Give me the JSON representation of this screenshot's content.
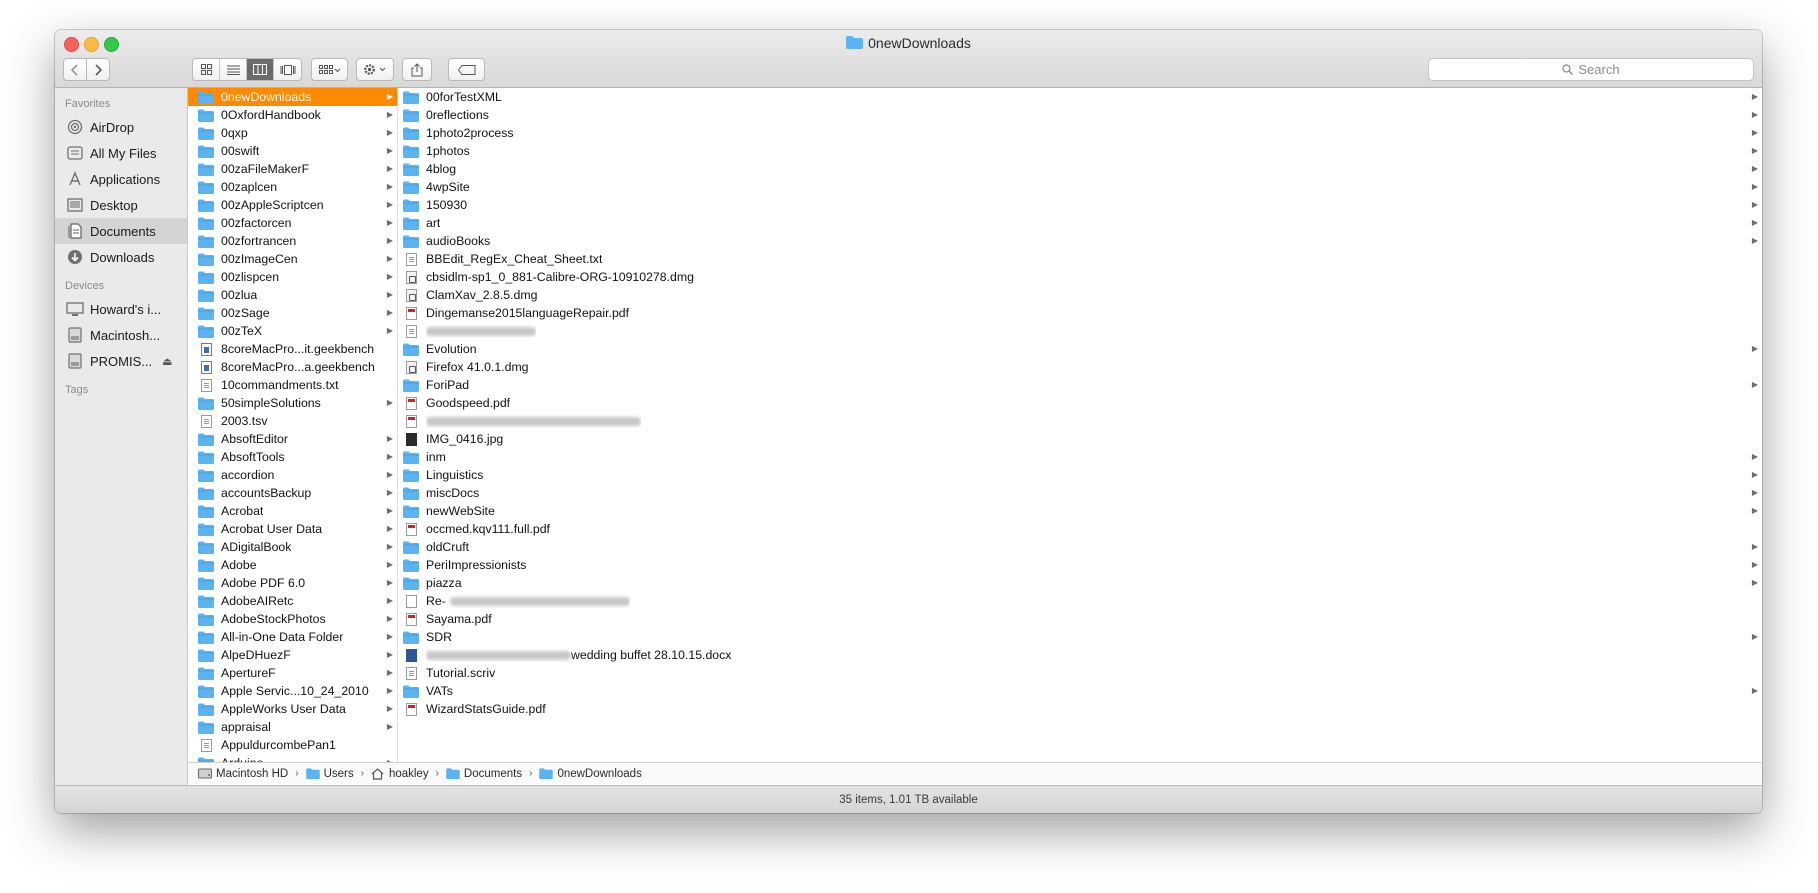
{
  "window": {
    "title": "0newDownloads"
  },
  "toolbar": {
    "search_placeholder": "Search"
  },
  "sidebar": {
    "favorites_header": "Favorites",
    "favorites": [
      {
        "label": "AirDrop",
        "icon": "airdrop-icon"
      },
      {
        "label": "All My Files",
        "icon": "all-my-files-icon"
      },
      {
        "label": "Applications",
        "icon": "applications-icon"
      },
      {
        "label": "Desktop",
        "icon": "desktop-icon"
      },
      {
        "label": "Documents",
        "icon": "documents-icon",
        "selected": true
      },
      {
        "label": "Downloads",
        "icon": "downloads-icon"
      }
    ],
    "devices_header": "Devices",
    "devices": [
      {
        "label": "Howard's i...",
        "icon": "computer-icon"
      },
      {
        "label": "Macintosh...",
        "icon": "disk-icon"
      },
      {
        "label": "PROMIS...",
        "icon": "disk-icon",
        "eject": "⏏"
      }
    ],
    "tags_header": "Tags"
  },
  "column1": [
    {
      "name": "0newDownloads",
      "type": "folder",
      "arrow": true,
      "selected": true
    },
    {
      "name": "0OxfordHandbook",
      "type": "folder",
      "arrow": true
    },
    {
      "name": "0qxp",
      "type": "folder",
      "arrow": true
    },
    {
      "name": "00swift",
      "type": "folder",
      "arrow": true
    },
    {
      "name": "00zaFileMakerF",
      "type": "folder",
      "arrow": true
    },
    {
      "name": "00zaplcen",
      "type": "folder",
      "arrow": true
    },
    {
      "name": "00zAppleScriptcen",
      "type": "folder",
      "arrow": true
    },
    {
      "name": "00zfactorcen",
      "type": "folder",
      "arrow": true
    },
    {
      "name": "00zfortrancen",
      "type": "folder",
      "arrow": true
    },
    {
      "name": "00zImageCen",
      "type": "folder",
      "arrow": true
    },
    {
      "name": "00zlispcen",
      "type": "folder",
      "arrow": true
    },
    {
      "name": "00zlua",
      "type": "folder",
      "arrow": true
    },
    {
      "name": "00zSage",
      "type": "folder",
      "arrow": true
    },
    {
      "name": "00zTeX",
      "type": "folder",
      "arrow": true
    },
    {
      "name": "8coreMacPro...it.geekbench",
      "type": "gb"
    },
    {
      "name": "8coreMacPro...a.geekbench",
      "type": "gb"
    },
    {
      "name": "10commandments.txt",
      "type": "txt"
    },
    {
      "name": "50simpleSolutions",
      "type": "folder",
      "arrow": true
    },
    {
      "name": "2003.tsv",
      "type": "txt"
    },
    {
      "name": "AbsoftEditor",
      "type": "folder",
      "arrow": true
    },
    {
      "name": "AbsoftTools",
      "type": "folder",
      "arrow": true
    },
    {
      "name": "accordion",
      "type": "folder",
      "arrow": true
    },
    {
      "name": "accountsBackup",
      "type": "folder",
      "arrow": true
    },
    {
      "name": "Acrobat",
      "type": "folder",
      "arrow": true
    },
    {
      "name": "Acrobat User Data",
      "type": "folder",
      "arrow": true
    },
    {
      "name": "ADigitalBook",
      "type": "folder",
      "arrow": true
    },
    {
      "name": "Adobe",
      "type": "folder",
      "arrow": true
    },
    {
      "name": "Adobe PDF 6.0",
      "type": "folder",
      "arrow": true
    },
    {
      "name": "AdobeAIRetc",
      "type": "folder",
      "arrow": true
    },
    {
      "name": "AdobeStockPhotos",
      "type": "folder",
      "arrow": true
    },
    {
      "name": "All-in-One Data Folder",
      "type": "folder",
      "arrow": true
    },
    {
      "name": "AlpeDHuezF",
      "type": "folder",
      "arrow": true
    },
    {
      "name": "ApertureF",
      "type": "folder",
      "arrow": true
    },
    {
      "name": "Apple Servic...10_24_2010",
      "type": "folder",
      "arrow": true
    },
    {
      "name": "AppleWorks User Data",
      "type": "folder",
      "arrow": true
    },
    {
      "name": "appraisal",
      "type": "folder",
      "arrow": true
    },
    {
      "name": "AppuldurcombePan1",
      "type": "txt"
    },
    {
      "name": "Arduino",
      "type": "folder",
      "arrow": true
    }
  ],
  "column2": [
    {
      "name": "00forTestXML",
      "type": "folder",
      "arrow": true
    },
    {
      "name": "0reflections",
      "type": "folder",
      "arrow": true
    },
    {
      "name": "1photo2process",
      "type": "folder",
      "arrow": true
    },
    {
      "name": "1photos",
      "type": "folder",
      "arrow": true
    },
    {
      "name": "4blog",
      "type": "folder",
      "arrow": true
    },
    {
      "name": "4wpSite",
      "type": "folder",
      "arrow": true
    },
    {
      "name": "150930",
      "type": "folder",
      "arrow": true
    },
    {
      "name": "art",
      "type": "folder",
      "arrow": true
    },
    {
      "name": "audioBooks",
      "type": "folder",
      "arrow": true
    },
    {
      "name": "BBEdit_RegEx_Cheat_Sheet.txt",
      "type": "txt"
    },
    {
      "name": "cbsidlm-sp1_0_881-Calibre-ORG-10910278.dmg",
      "type": "dmg"
    },
    {
      "name": "ClamXav_2.8.5.dmg",
      "type": "dmg"
    },
    {
      "name": "Dingemanse2015languageRepair.pdf",
      "type": "pdf"
    },
    {
      "name": "",
      "type": "txt",
      "blur": 110
    },
    {
      "name": "Evolution",
      "type": "folder",
      "arrow": true
    },
    {
      "name": "Firefox 41.0.1.dmg",
      "type": "dmg"
    },
    {
      "name": "ForiPad",
      "type": "folder",
      "arrow": true
    },
    {
      "name": "Goodspeed.pdf",
      "type": "pdf"
    },
    {
      "name": "",
      "type": "pdf",
      "blur": 215
    },
    {
      "name": "IMG_0416.jpg",
      "type": "img"
    },
    {
      "name": "inm",
      "type": "folder",
      "arrow": true
    },
    {
      "name": "Linguistics",
      "type": "folder",
      "arrow": true
    },
    {
      "name": "miscDocs",
      "type": "folder",
      "arrow": true
    },
    {
      "name": "newWebSite",
      "type": "folder",
      "arrow": true
    },
    {
      "name": "occmed.kqv111.full.pdf",
      "type": "pdf"
    },
    {
      "name": "oldCruft",
      "type": "folder",
      "arrow": true
    },
    {
      "name": "PeriImpressionists",
      "type": "folder",
      "arrow": true
    },
    {
      "name": "piazza",
      "type": "folder",
      "arrow": true
    },
    {
      "name": "Re-",
      "type": "blank",
      "blur": 180
    },
    {
      "name": "Sayama.pdf",
      "type": "pdf"
    },
    {
      "name": "SDR",
      "type": "folder",
      "arrow": true
    },
    {
      "name": "wedding buffet 28.10.15.docx",
      "type": "word",
      "blurBefore": 145
    },
    {
      "name": "Tutorial.scriv",
      "type": "txt"
    },
    {
      "name": "VATs",
      "type": "folder",
      "arrow": true
    },
    {
      "name": "WizardStatsGuide.pdf",
      "type": "pdf"
    }
  ],
  "pathbar": [
    {
      "label": "Macintosh HD",
      "icon": "hard-disk-icon"
    },
    {
      "label": "Users",
      "icon": "folder-icon"
    },
    {
      "label": "hoakley",
      "icon": "home-icon"
    },
    {
      "label": "Documents",
      "icon": "folder-icon"
    },
    {
      "label": "0newDownloads",
      "icon": "folder-icon"
    }
  ],
  "status": {
    "text": "35 items, 1.01 TB available"
  },
  "colors": {
    "selection": "#ff8a00",
    "folder": "#5cb3f2",
    "sidebar_bg": "#eaeaea"
  }
}
